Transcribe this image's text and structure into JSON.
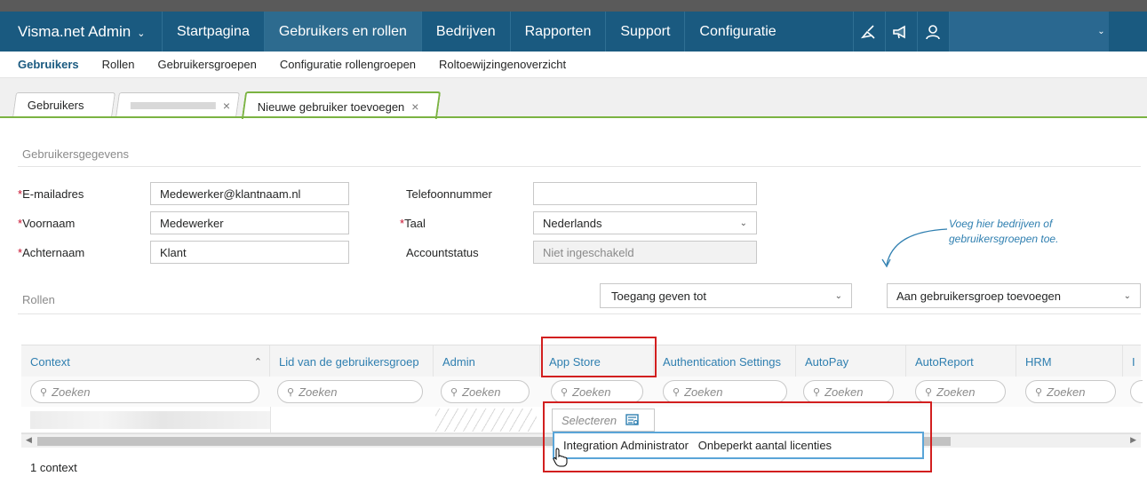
{
  "topnav": {
    "brand": "Visma.net Admin",
    "items": [
      {
        "label": "Startpagina",
        "active": false
      },
      {
        "label": "Gebruikers en rollen",
        "active": true
      },
      {
        "label": "Bedrijven",
        "active": false
      },
      {
        "label": "Rapporten",
        "active": false
      },
      {
        "label": "Support",
        "active": false
      },
      {
        "label": "Configuratie",
        "active": false
      }
    ],
    "icons": [
      "broom-icon",
      "megaphone-icon",
      "user-icon"
    ]
  },
  "subnav": {
    "items": [
      {
        "label": "Gebruikers",
        "active": true
      },
      {
        "label": "Rollen",
        "active": false
      },
      {
        "label": "Gebruikersgroepen",
        "active": false
      },
      {
        "label": "Configuratie rollengroepen",
        "active": false
      },
      {
        "label": "Roltoewijzingenoverzicht",
        "active": false
      }
    ]
  },
  "tabs": {
    "tab1": "Gebruikers",
    "tab3": "Nieuwe gebruiker toevoegen",
    "close": "×"
  },
  "form": {
    "section_title": "Gebruikersgegevens",
    "required_mark": "*",
    "email_label": "E-mailadres",
    "email_value": "Medewerker@klantnaam.nl",
    "firstname_label": "Voornaam",
    "firstname_value": "Medewerker",
    "lastname_label": "Achternaam",
    "lastname_value": "Klant",
    "phone_label": "Telefoonnummer",
    "phone_value": "",
    "language_label": "Taal",
    "language_value": "Nederlands",
    "status_label": "Accountstatus",
    "status_value": "Niet ingeschakeld"
  },
  "hint": {
    "line1": "Voeg hier bedrijven of",
    "line2": "gebruikersgroepen toe."
  },
  "roles": {
    "section_title": "Rollen",
    "access_dropdown": "Toegang geven tot",
    "group_dropdown": "Aan gebruikersgroep toevoegen"
  },
  "grid": {
    "columns": [
      "Context",
      "Lid van de gebruikersgroep",
      "Admin",
      "App Store",
      "Authentication Settings",
      "AutoPay",
      "AutoReport",
      "HRM",
      "I"
    ],
    "search_placeholder": "Zoeken",
    "select_label": "Selecteren",
    "popup_option": "Integration Administrator   Onbeperkt aantal licenties",
    "footer": "1 context"
  },
  "colors": {
    "nav_bg": "#1a5a80",
    "accent_blue": "#2f7fb0",
    "tab_green": "#7bb342",
    "highlight_red": "#d21f1f",
    "required_red": "#c8102e"
  }
}
